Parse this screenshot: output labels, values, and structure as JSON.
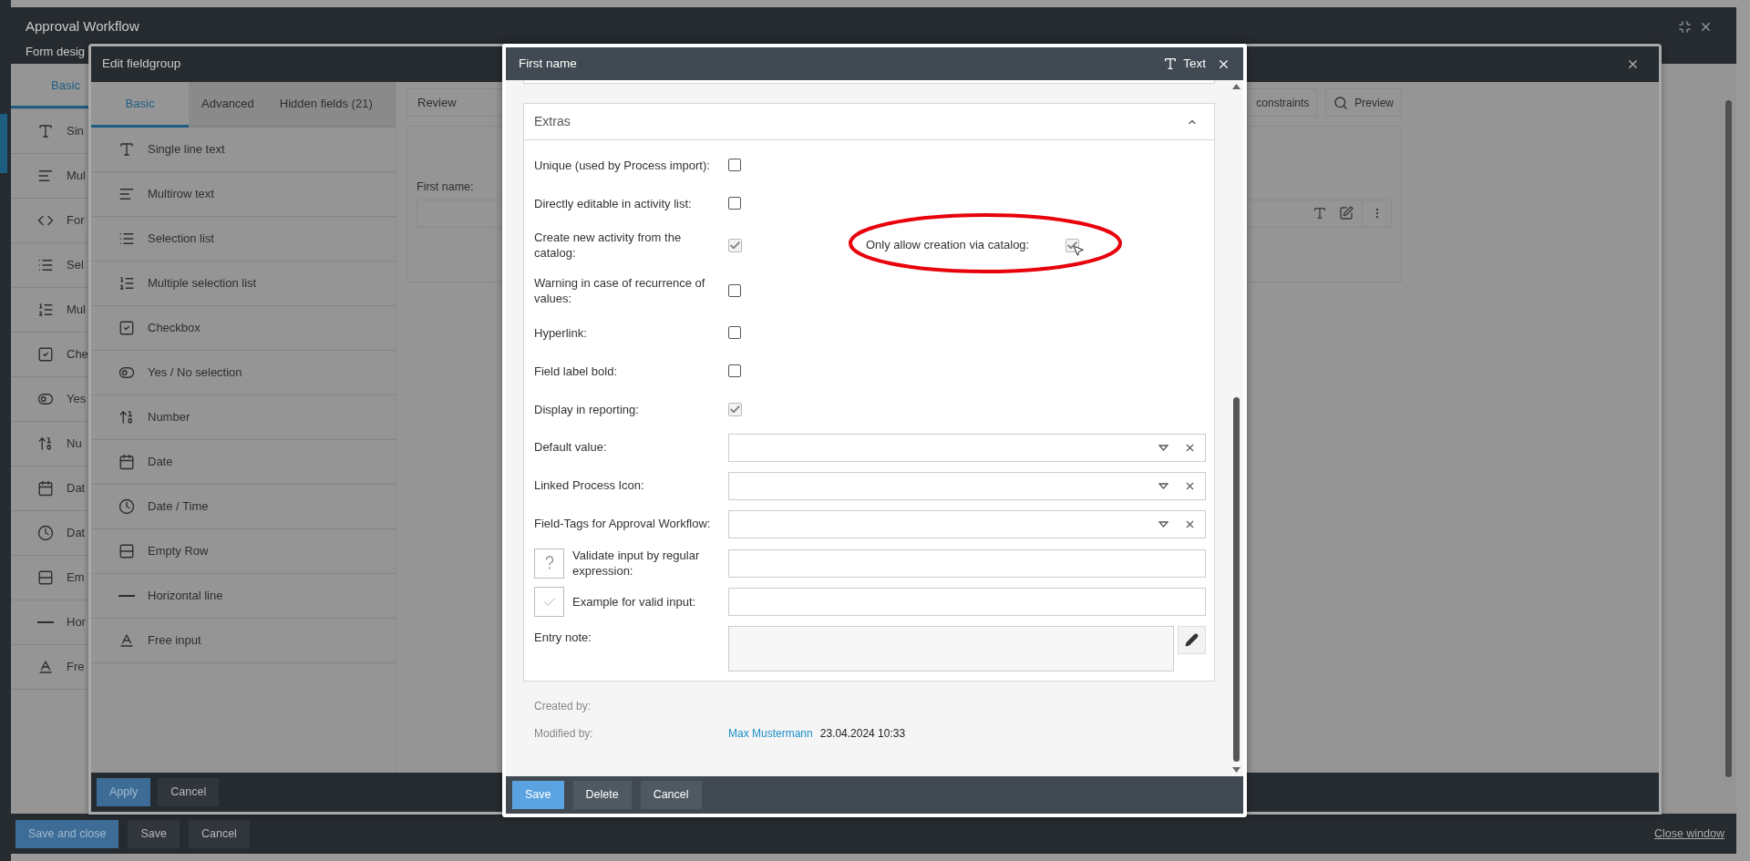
{
  "main_window": {
    "title": "Approval Workflow",
    "subtitle": "Form desig",
    "tabs": [
      {
        "label": "Basic",
        "selected": true
      }
    ],
    "field_types": [
      {
        "kind": "text",
        "label": "Sin"
      },
      {
        "kind": "multiline",
        "label": "Mul"
      },
      {
        "kind": "formula",
        "label": "For"
      },
      {
        "kind": "select",
        "label": "Sel"
      },
      {
        "kind": "multiselect",
        "label": "Mul"
      },
      {
        "kind": "checkbox",
        "label": "Che"
      },
      {
        "kind": "toggle",
        "label": "Yes"
      },
      {
        "kind": "number",
        "label": "Nu"
      },
      {
        "kind": "date",
        "label": "Dat"
      },
      {
        "kind": "datetime",
        "label": "Dat"
      },
      {
        "kind": "emptyrow",
        "label": "Em"
      },
      {
        "kind": "line",
        "label": "Hor"
      },
      {
        "kind": "free",
        "label": "Fre"
      }
    ],
    "footer_buttons": [
      {
        "label": "Save and close",
        "primary": true
      },
      {
        "label": "Save",
        "primary": false
      },
      {
        "label": "Cancel",
        "primary": false
      }
    ],
    "close_link": "Close window"
  },
  "fieldgroup_dialog": {
    "title": "Edit fieldgroup",
    "tabs": [
      {
        "label": "Basic",
        "selected": true
      },
      {
        "label": "Advanced",
        "selected": false
      },
      {
        "label": "Hidden fields (21)",
        "selected": false
      }
    ],
    "field_types": [
      {
        "kind": "text",
        "label": "Single line text"
      },
      {
        "kind": "multiline",
        "label": "Multirow text"
      },
      {
        "kind": "select",
        "label": "Selection list"
      },
      {
        "kind": "multiselect",
        "label": "Multiple selection list"
      },
      {
        "kind": "checkbox",
        "label": "Checkbox"
      },
      {
        "kind": "toggle",
        "label": "Yes / No selection"
      },
      {
        "kind": "number",
        "label": "Number"
      },
      {
        "kind": "date",
        "label": "Date"
      },
      {
        "kind": "datetime",
        "label": "Date / Time"
      },
      {
        "kind": "emptyrow",
        "label": "Empty Row"
      },
      {
        "kind": "line",
        "label": "Horizontal line"
      },
      {
        "kind": "free",
        "label": "Free input"
      }
    ],
    "review_label": "Review",
    "constraints_label": "constraints",
    "preview_label": "Preview",
    "form_field_label": "First name:",
    "footer_buttons": [
      {
        "label": "Apply",
        "primary": true
      },
      {
        "label": "Cancel",
        "primary": false
      }
    ]
  },
  "field_dialog": {
    "title": "First name",
    "type_label": "Text",
    "extras": {
      "title": "Extras",
      "expanded": true,
      "options": [
        {
          "label": "Unique (used by Process import):",
          "checked": false
        },
        {
          "label": "Directly editable in activity list:",
          "checked": false
        },
        {
          "label": "Create new activity from the catalog:",
          "checked": true,
          "side_option": {
            "label": "Only allow creation via catalog:",
            "checked": true,
            "highlighted": true
          }
        },
        {
          "label": "Warning in case of recurrence of values:",
          "checked": false
        },
        {
          "label": "Hyperlink:",
          "checked": false
        },
        {
          "label": "Field label bold:",
          "checked": false
        },
        {
          "label": "Display in reporting:",
          "checked": true
        }
      ],
      "selects": [
        {
          "label": "Default value:"
        },
        {
          "label": "Linked Process Icon:"
        },
        {
          "label": "Field-Tags for Approval Workflow:"
        }
      ],
      "validation_fields": [
        {
          "kind": "regex",
          "label": "Validate input by regular expression:"
        },
        {
          "kind": "example",
          "label": "Example for valid input:"
        }
      ],
      "entry_note": {
        "label": "Entry note:"
      }
    },
    "created_label": "Created by:",
    "modified_label": "Modified by:",
    "modified_user": "Max Mustermann",
    "modified_date": "23.04.2024 10:33",
    "footer_buttons": [
      {
        "label": "Save",
        "primary": true
      },
      {
        "label": "Delete",
        "primary": false
      },
      {
        "label": "Cancel",
        "primary": false
      }
    ]
  }
}
